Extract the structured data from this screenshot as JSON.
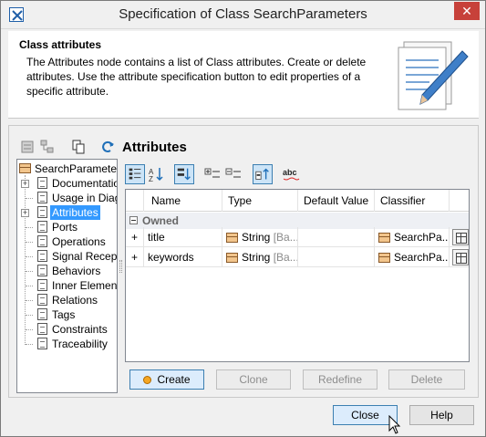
{
  "window": {
    "title": "Specification of Class SearchParameters",
    "close_glyph": "✕"
  },
  "header": {
    "title": "Class attributes",
    "description": "The Attributes node contains a list of Class attributes. Create or delete attributes. Use the attribute specification button to edit properties of a specific attribute."
  },
  "section_title": "Attributes",
  "tree": {
    "root": "SearchParameters",
    "items": [
      {
        "label": "Documentation",
        "expandable": true
      },
      {
        "label": "Usage in Diagra",
        "expandable": false
      },
      {
        "label": "Attributes",
        "expandable": true,
        "selected": true
      },
      {
        "label": "Ports",
        "expandable": false
      },
      {
        "label": "Operations",
        "expandable": false
      },
      {
        "label": "Signal Receptio",
        "expandable": false
      },
      {
        "label": "Behaviors",
        "expandable": false
      },
      {
        "label": "Inner Elements",
        "expandable": false
      },
      {
        "label": "Relations",
        "expandable": false
      },
      {
        "label": "Tags",
        "expandable": false
      },
      {
        "label": "Constraints",
        "expandable": false
      },
      {
        "label": "Traceability",
        "expandable": false
      }
    ]
  },
  "grid": {
    "columns": [
      "Name",
      "Type",
      "Default Value",
      "Classifier"
    ],
    "group": "Owned",
    "rows": [
      {
        "name": "title",
        "type": "String",
        "type_suffix": "[Ba...",
        "default": "",
        "classifier": "SearchPa..."
      },
      {
        "name": "keywords",
        "type": "String",
        "type_suffix": "[Ba...",
        "default": "",
        "classifier": "SearchPa..."
      }
    ]
  },
  "actions": {
    "create": "Create",
    "clone": "Clone",
    "redefine": "Redefine",
    "delete": "Delete"
  },
  "dialog_buttons": {
    "close": "Close",
    "help": "Help"
  },
  "toolbar_icons": {
    "left": [
      "collapse-all-icon",
      "show-hierarchy-icon",
      "copy-icon",
      "refresh-icon"
    ],
    "right": [
      "sort-by-property-icon",
      "sort-alphabetically-icon",
      "group-by-owner-icon",
      "expand-all-icon",
      "collapse-rows-icon",
      "show-inherited-icon",
      "spell-check-icon"
    ]
  },
  "colors": {
    "selection": "#3399ff",
    "toolbar_active": "#cce4f7",
    "close_button": "#c7413a"
  }
}
